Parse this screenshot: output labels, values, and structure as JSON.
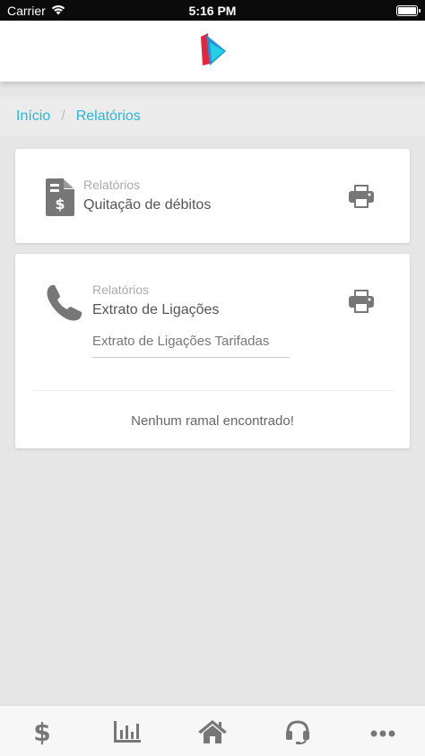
{
  "status_bar": {
    "carrier": "Carrier",
    "time": "5:16 PM"
  },
  "breadcrumb": {
    "home": "Início",
    "separator": "/",
    "current": "Relatórios"
  },
  "cards": [
    {
      "subtitle": "Relatórios",
      "title": "Quitação de débitos",
      "icon": "invoice-dollar-icon"
    },
    {
      "subtitle": "Relatórios",
      "title": "Extrato de Ligações",
      "icon": "phone-icon",
      "select_value": "Extrato de Ligações Tarifadas",
      "empty_message": "Nenhum ramal encontrado!"
    }
  ],
  "bottom_nav": [
    {
      "icon": "dollar-icon"
    },
    {
      "icon": "bar-chart-icon"
    },
    {
      "icon": "home-icon"
    },
    {
      "icon": "headset-icon"
    },
    {
      "icon": "more-icon"
    }
  ],
  "colors": {
    "accent": "#29b6d8",
    "icon_gray": "#777777",
    "background": "#e6e6e6",
    "logo_red": "#e5253b",
    "logo_blue": "#1f8fe0",
    "logo_cyan": "#22d0e0"
  }
}
